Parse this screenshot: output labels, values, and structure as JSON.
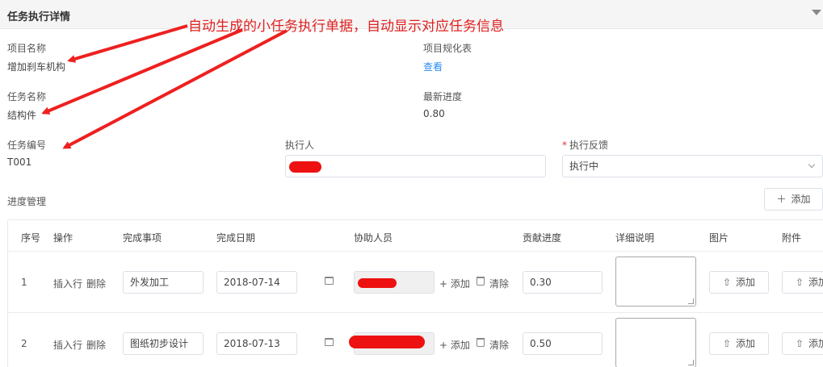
{
  "header": {
    "title": "任务执行详情"
  },
  "annotation": {
    "text": "自动生成的小任务执行单据，自动显示对应任务信息",
    "color": "#e02020"
  },
  "fields": {
    "project_name_label": "项目名称",
    "project_name_value": "增加刹车机构",
    "project_spec_label": "项目规化表",
    "project_spec_link": "查看",
    "task_name_label": "任务名称",
    "task_name_value": "结构件",
    "latest_progress_label": "最新进度",
    "latest_progress_value": "0.80",
    "task_no_label": "任务编号",
    "task_no_value": "T001",
    "executor_label": "执行人",
    "feedback_required_mark": "*",
    "feedback_label": "执行反馈",
    "feedback_value": "执行中"
  },
  "progress": {
    "section_label": "进度管理",
    "add_button": "添加",
    "columns": [
      "序号",
      "操作",
      "完成事项",
      "完成日期",
      "协助人员",
      "贡献进度",
      "详细说明",
      "图片",
      "附件"
    ],
    "rows": [
      {
        "index": "1",
        "insert": "插入行",
        "delete": "删除",
        "item": "外发加工",
        "date": "2018-07-14",
        "add_helper": "添加",
        "clear_helper": "清除",
        "contribution": "0.30",
        "image_add": "添加",
        "file_add": "添加"
      },
      {
        "index": "2",
        "insert": "插入行",
        "delete": "删除",
        "item": "图纸初步设计",
        "date": "2018-07-13",
        "add_helper": "添加",
        "clear_helper": "清除",
        "contribution": "0.50",
        "image_add": "添加",
        "file_add": "添加"
      }
    ]
  },
  "colors": {
    "link": "#2d8cf0",
    "redaction": "#ee1111",
    "required": "#e53935"
  }
}
